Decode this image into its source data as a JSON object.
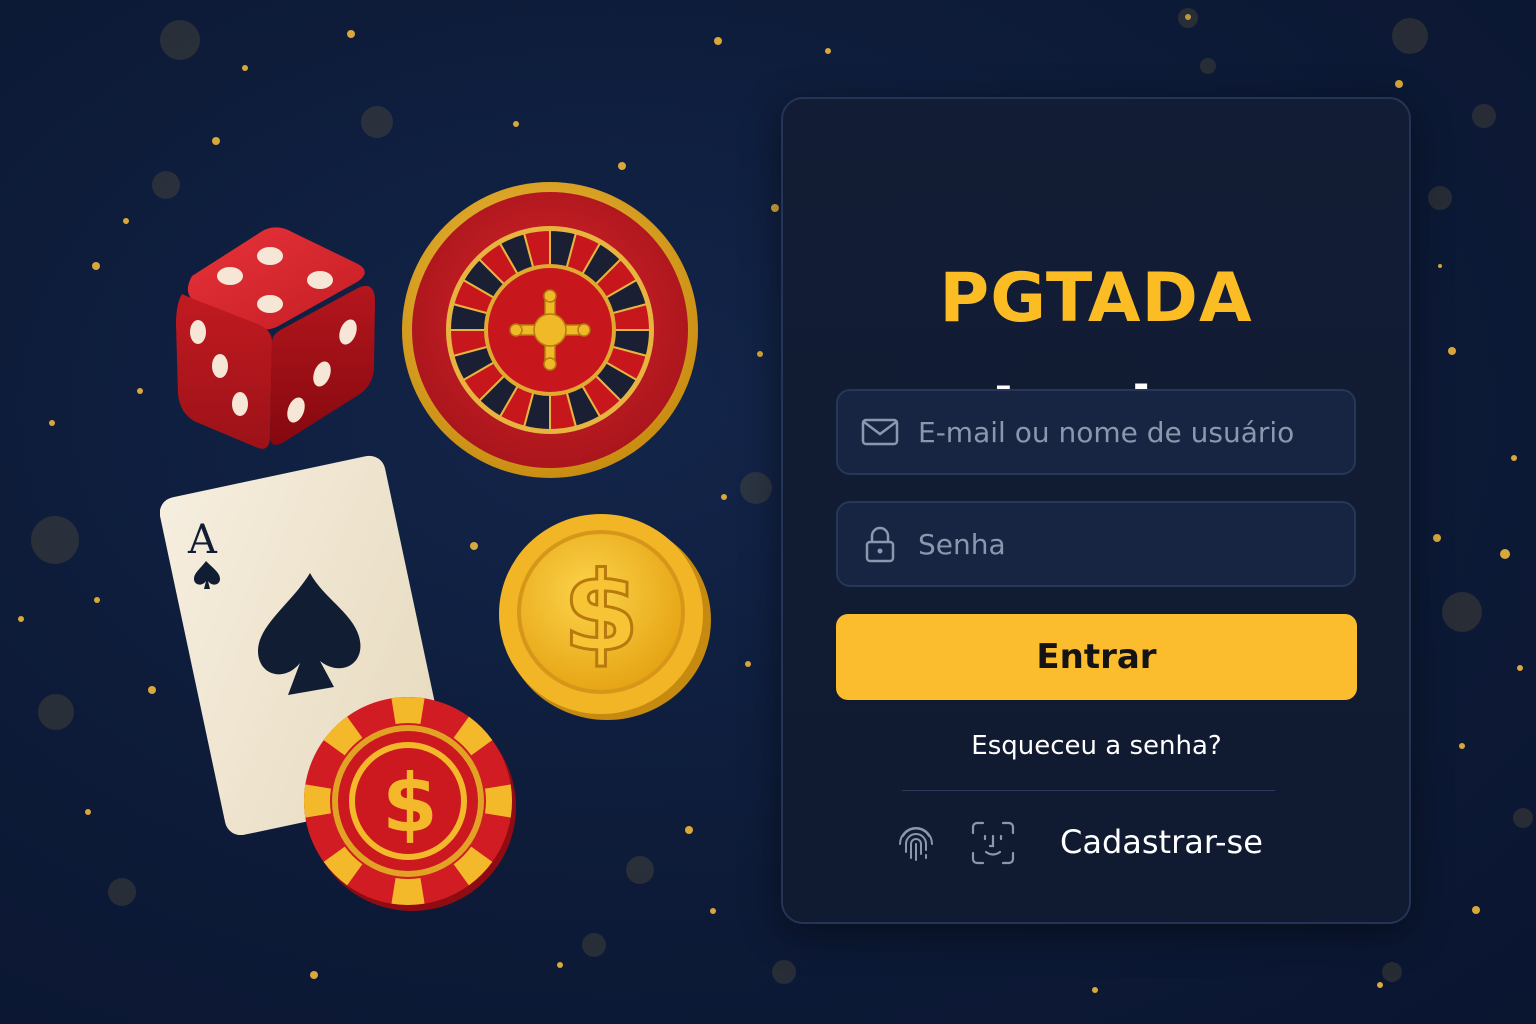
{
  "brand": "PGTADA",
  "title": "Login",
  "email_field": {
    "placeholder": "E-mail ou nome de usuário",
    "value": "",
    "icon": "envelope-icon"
  },
  "password_field": {
    "placeholder": "Senha",
    "value": "",
    "icon": "lock-icon"
  },
  "submit_label": "Entrar",
  "forgot_password_label": "Esqueceu a senha?",
  "signup_label": "Cadastrar-se",
  "biometric_icons": [
    "fingerprint-icon",
    "face-id-icon"
  ],
  "illustration": {
    "card_rank": "A",
    "coin_symbol": "$",
    "chip_symbol": "$"
  },
  "colors": {
    "background": "#0d1b38",
    "accent": "#fbbd23",
    "panel": "#121d35",
    "field": "#172543",
    "red": "#c8161d"
  }
}
